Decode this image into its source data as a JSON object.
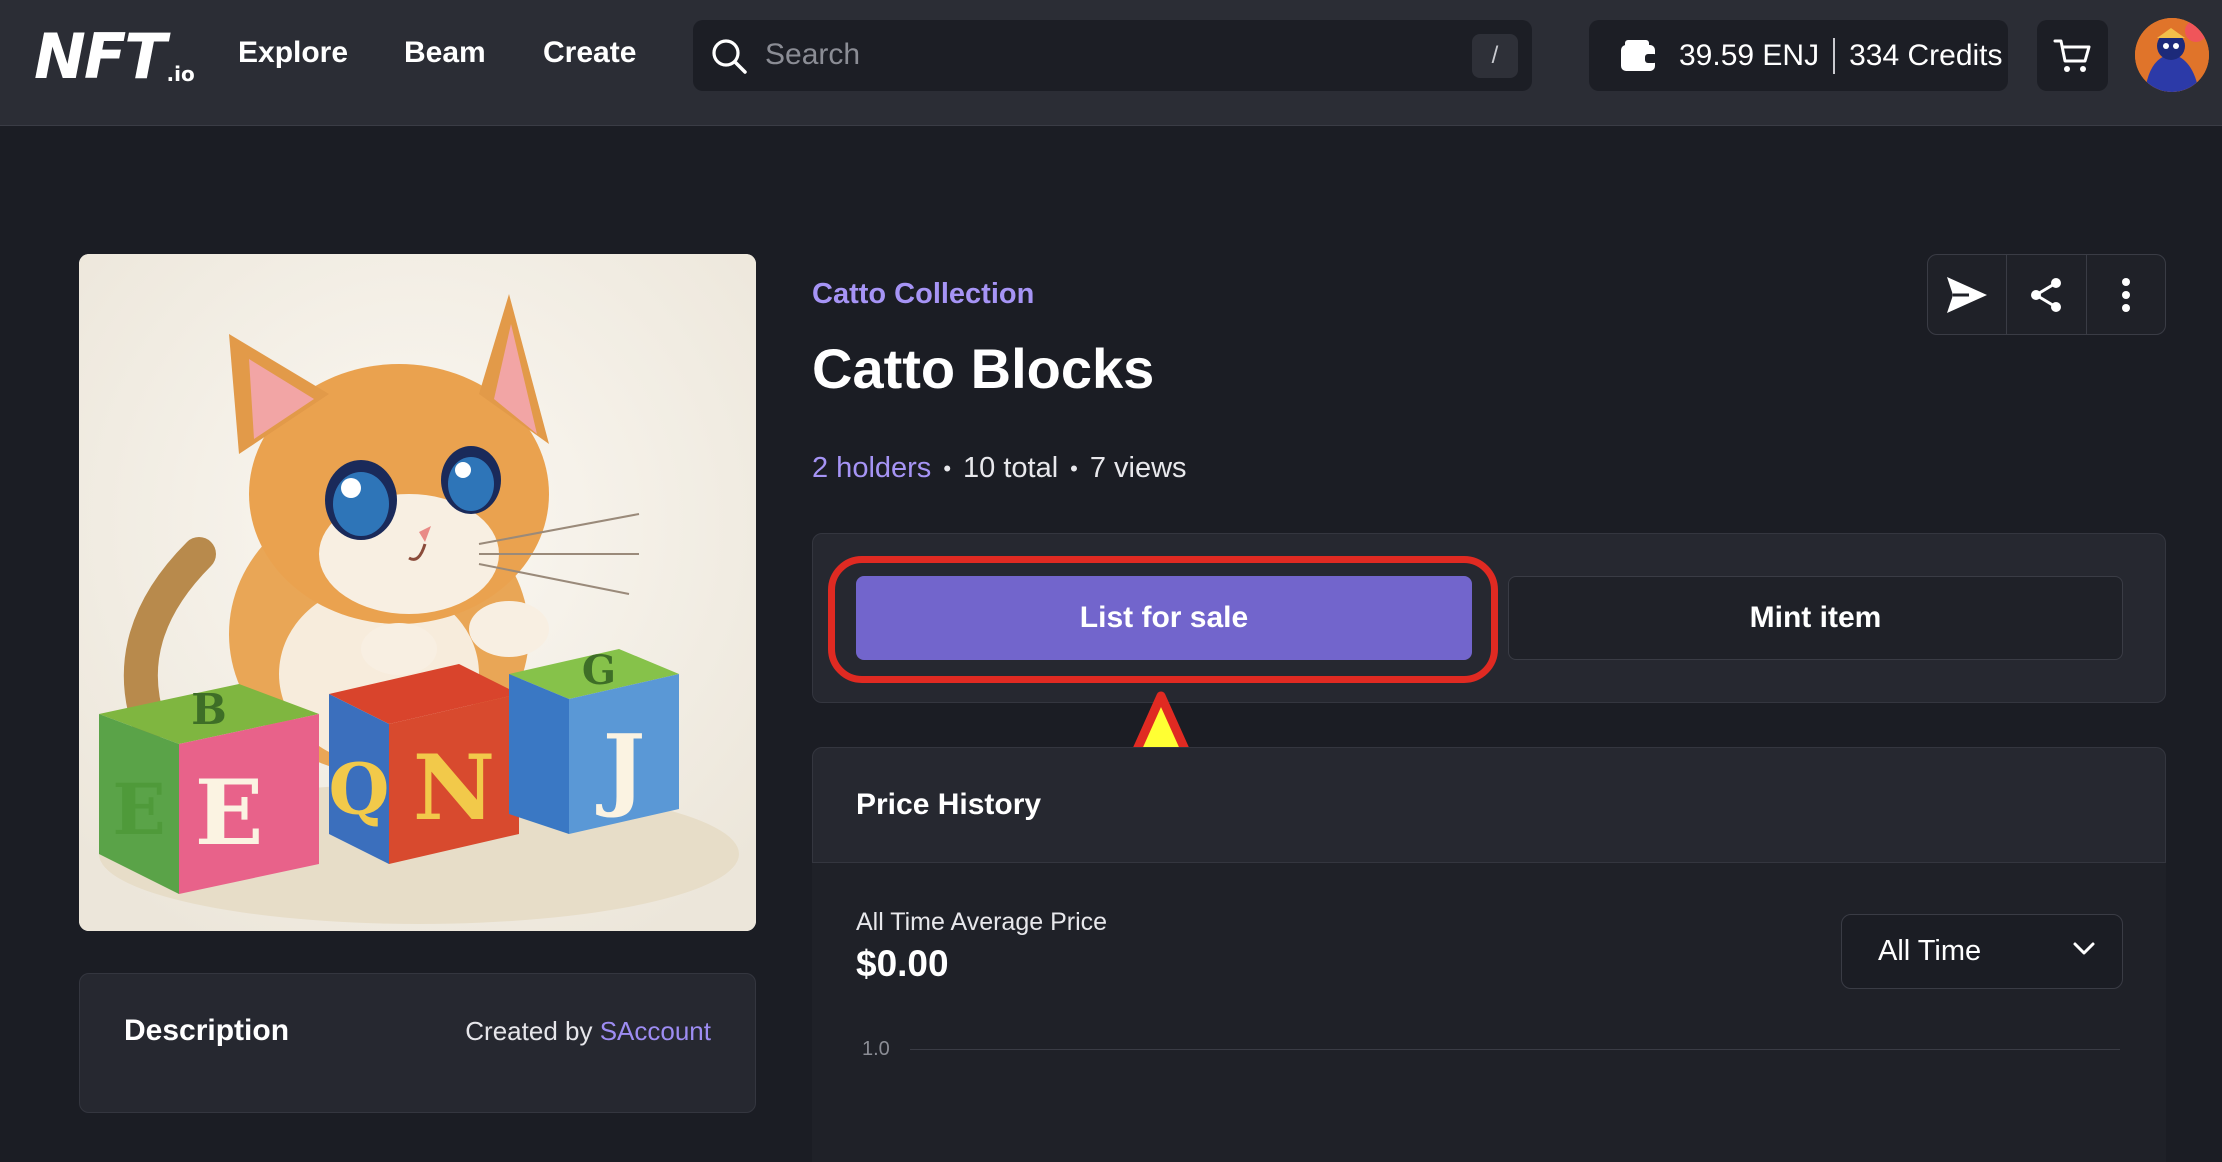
{
  "header": {
    "logo_text": "NFT",
    "logo_suffix": ".io",
    "nav": [
      "Explore",
      "Beam",
      "Create"
    ],
    "search": {
      "placeholder": "Search",
      "shortcut": "/"
    },
    "wallet": {
      "balance": "39.59 ENJ",
      "credits": "334 Credits"
    }
  },
  "item": {
    "collection": "Catto Collection",
    "title": "Catto Blocks",
    "holders": "2 holders",
    "total": "10 total",
    "views": "7 views"
  },
  "actions": {
    "list_for_sale": "List for sale",
    "mint_item": "Mint item"
  },
  "price_history": {
    "heading": "Price History",
    "avg_label": "All Time Average Price",
    "avg_value": "$0.00",
    "range_selected": "All Time",
    "y_tick_top": "1.0"
  },
  "description": {
    "heading": "Description",
    "created_by_label": "Created by",
    "creator": "SAccount"
  },
  "artwork": {
    "block_letters": [
      "E",
      "E",
      "Q",
      "N",
      "J",
      "G",
      "B"
    ]
  },
  "colors": {
    "accent": "#7265cc",
    "link": "#a694f5",
    "annotation_red": "#e02a22",
    "annotation_yellow": "#ffff33"
  }
}
